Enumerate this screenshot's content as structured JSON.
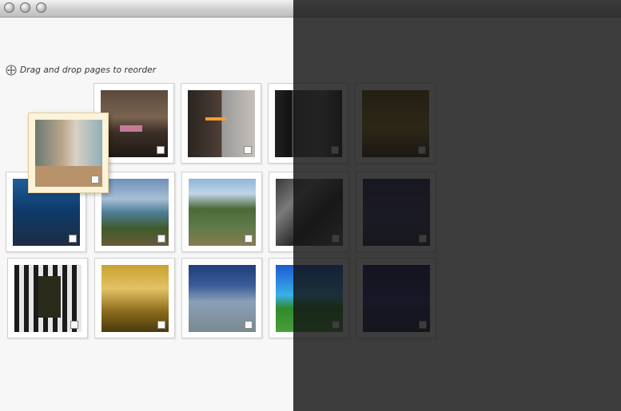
{
  "window": {
    "buttons": [
      "close",
      "minimize",
      "zoom"
    ]
  },
  "hint": {
    "icon": "move-icon",
    "text": "Drag and drop pages to reorder"
  },
  "pages": [
    {
      "picture": "bedroom"
    },
    {
      "picture": "fireplace"
    },
    {
      "picture": "dark-hallway"
    },
    {
      "picture": "gold-interior"
    },
    {
      "picture": "marina"
    },
    {
      "picture": "cliff-lake"
    },
    {
      "picture": "mountain-lake"
    },
    {
      "picture": "steel-structure"
    },
    {
      "picture": "dusk-sky"
    },
    {
      "picture": "striped-hallway"
    },
    {
      "picture": "bar-counter"
    },
    {
      "picture": "glass-terrace"
    },
    {
      "picture": "green-field"
    },
    {
      "picture": "horizon"
    }
  ],
  "dragged_page": {
    "picture": "living-room"
  },
  "colors": {
    "dragged_background": "#fcf3d9",
    "overlay": "#141414"
  }
}
